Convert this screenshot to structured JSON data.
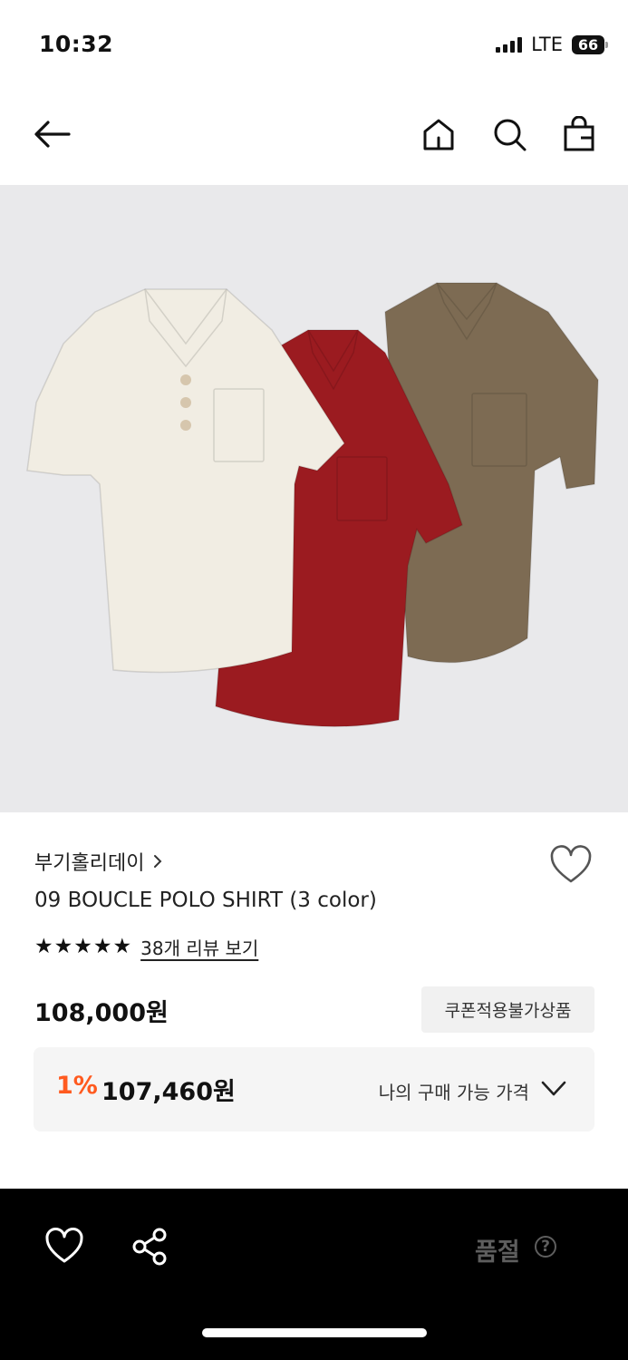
{
  "status_bar": {
    "time": "10:32",
    "network": "LTE",
    "battery": "66"
  },
  "nav": {
    "icons": [
      "back-arrow-icon",
      "home-icon",
      "search-icon",
      "shopping-bag-icon"
    ]
  },
  "product": {
    "brand": "부기홀리데이",
    "name": "09 BOUCLE POLO SHIRT (3 color)",
    "rating_stars": 5,
    "review_link": "38개 리뷰 보기",
    "price": "108,000원",
    "coupon_badge": "쿠폰적용불가상품",
    "discount_rate": "1%",
    "discounted_price": "107,460원",
    "my_price_label": "나의 구매 가능 가격",
    "colors": [
      "#f1ede3",
      "#9b1b20",
      "#7d6b53"
    ]
  },
  "bottom_bar": {
    "status": "품절",
    "help_glyph": "?"
  }
}
